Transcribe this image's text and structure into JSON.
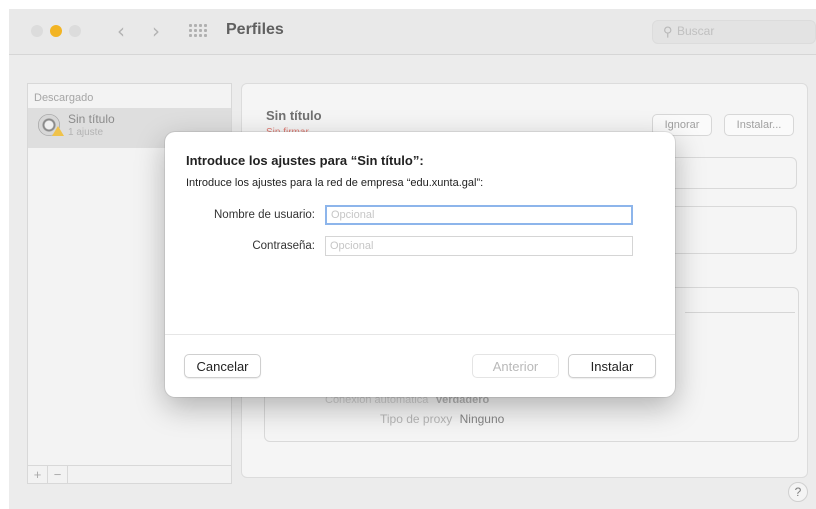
{
  "window": {
    "title": "Perfiles",
    "search_placeholder": "Buscar"
  },
  "sidebar": {
    "header": "Descargado",
    "profile": {
      "name": "Sin título",
      "count": "1 ajuste"
    },
    "add_label": "+",
    "remove_label": "−"
  },
  "detail": {
    "title": "Sin título",
    "status": "Sin firmar",
    "ignore_label": "Ignorar",
    "install_label": "Instalar...",
    "rows": [
      {
        "key": "Conexión automática",
        "value": "Verdadero"
      },
      {
        "key": "Tipo de proxy",
        "value": "Ninguno"
      }
    ]
  },
  "dialog": {
    "title": "Introduce los ajustes para “Sin título”:",
    "subtitle": "Introduce los ajustes para la red de empresa “edu.xunta.gal”:",
    "username_label": "Nombre de usuario:",
    "username_placeholder": "Opcional",
    "password_label": "Contraseña:",
    "password_placeholder": "Opcional",
    "cancel_label": "Cancelar",
    "previous_label": "Anterior",
    "install_label": "Instalar"
  },
  "help_label": "?",
  "colors": {
    "focus_ring": "#8db5eb",
    "minimize_dot": "#f2b424",
    "unsigned_text": "#e07c74",
    "warning_badge": "#efc24a"
  }
}
